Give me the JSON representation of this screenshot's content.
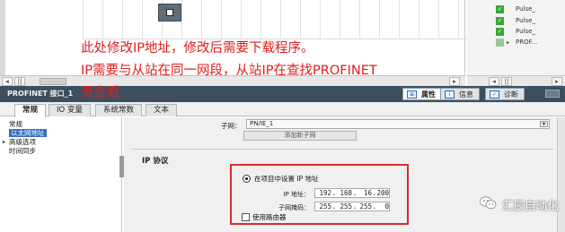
{
  "device_list": {
    "rows": [
      {
        "label": "Pulse_",
        "checked": true
      },
      {
        "label": "Pulse_",
        "checked": true
      },
      {
        "label": "Pulse_",
        "checked": true
      },
      {
        "label": "PROF...",
        "checked": false,
        "expand": "▸"
      }
    ]
  },
  "scroll": {
    "left": "◂",
    "right": "▸",
    "divider": "||"
  },
  "panel_header": {
    "title": "PROFINET 接口_1",
    "tabs": [
      {
        "label": "属性",
        "icon": "properties-icon",
        "glyph": "≡"
      },
      {
        "label": "信息",
        "icon": "info-icon",
        "glyph": "i"
      },
      {
        "label": "诊断",
        "icon": "diagnostics-icon",
        "glyph": "✓"
      }
    ]
  },
  "tabs": [
    "常规",
    "IO 变量",
    "系统常数",
    "文本"
  ],
  "nav": {
    "items": [
      "常规",
      "以太网地址",
      "高级选项",
      "时间同步"
    ],
    "expand_arrow": "▸"
  },
  "content": {
    "subnet_label": "子网：",
    "subnet_value": "PN/IE_1",
    "subnet_dropdown": "▾",
    "add_subnet_button": "添加新子网",
    "section_title": "IP 协议",
    "radio_label": "在项目中设置 IP 地址",
    "ip_label": "IP 地址：",
    "ip_octets": [
      "192",
      "168",
      "16",
      "200"
    ],
    "mask_label": "子网掩码：",
    "mask_octets": [
      "255",
      "255",
      "255",
      "0"
    ],
    "octet_separator": ".",
    "router_label": "使用路由器"
  },
  "annotation": {
    "line1": "此处修改IP地址，修改后需要下载程序。",
    "line2": "IP需要与从站在同一网段，从站IP在查找PROFINET",
    "line3": "录查看"
  },
  "watermark": {
    "text": "汇辰自动化"
  },
  "colors": {
    "annotation_red": "#e11d1d",
    "highlight_red": "#d92b2b",
    "panel_header": "#3d4f5f",
    "selected_blue": "#2f6fc4",
    "check_green": "#3aa53a"
  }
}
